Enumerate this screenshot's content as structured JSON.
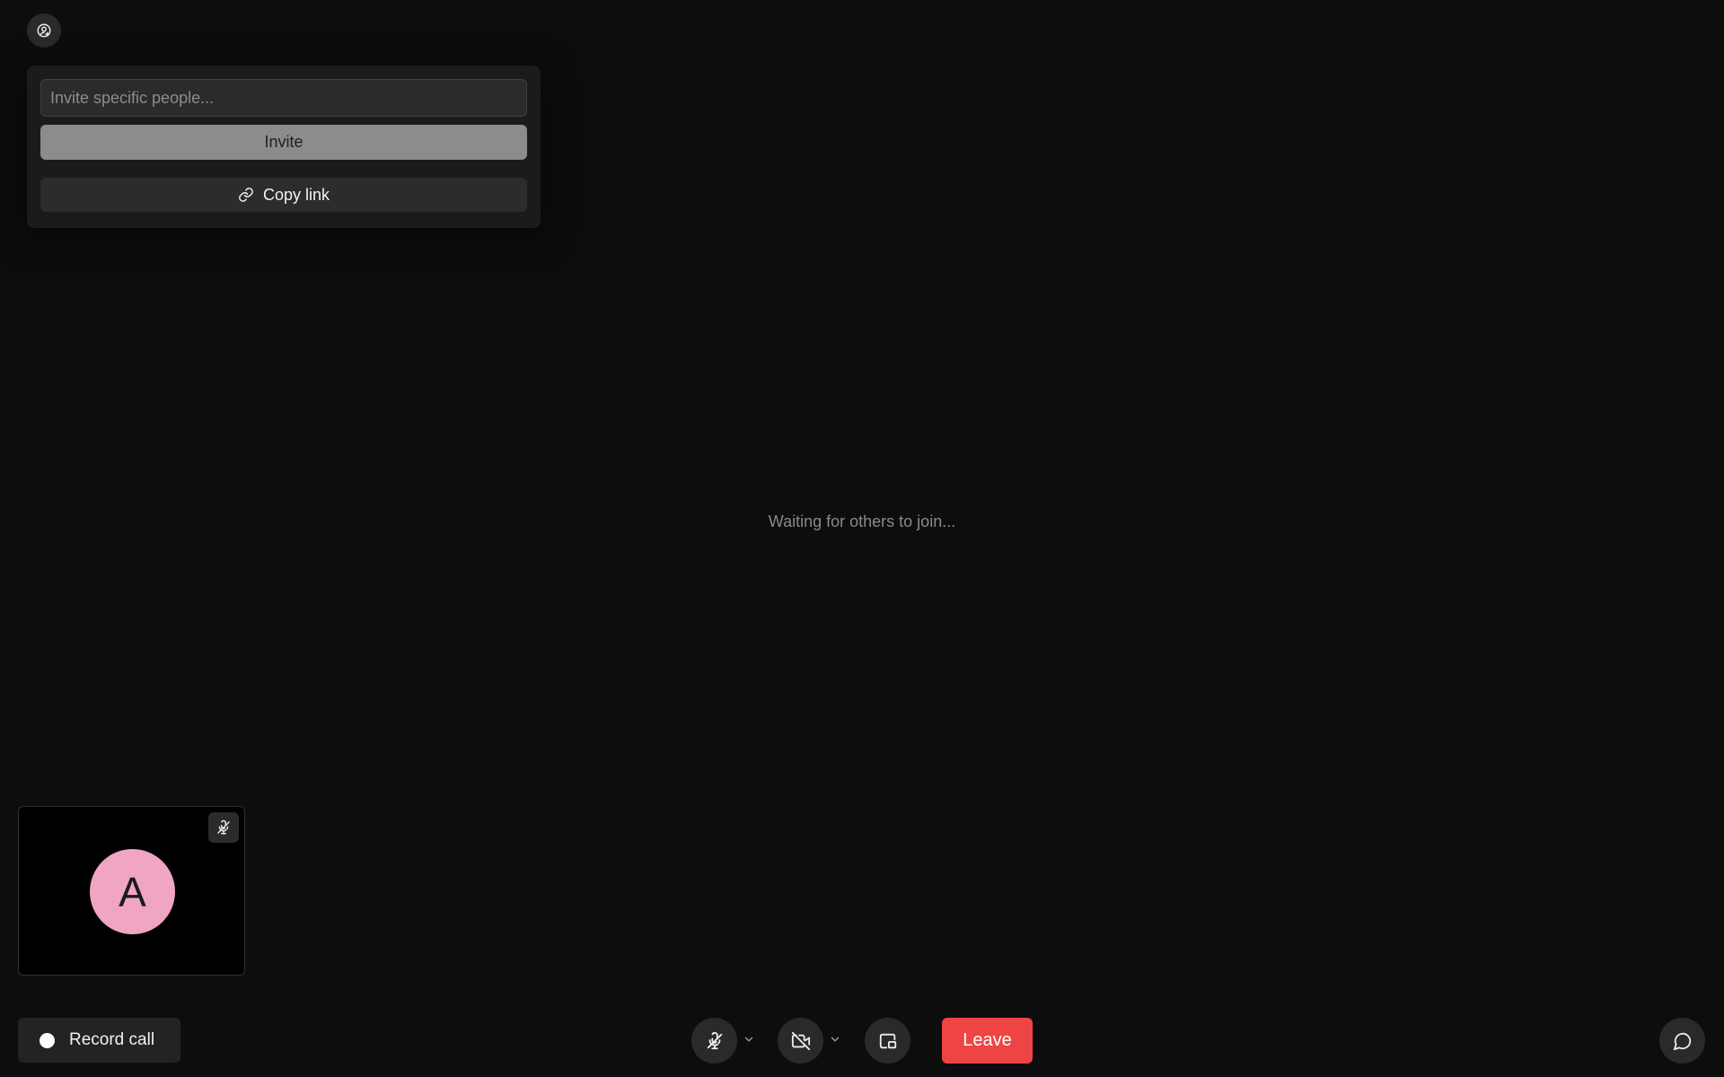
{
  "invite_panel": {
    "toggle_icon": "user-add-icon",
    "input_placeholder": "Invite specific people...",
    "invite_label": "Invite",
    "copy_link_label": "Copy link",
    "copy_link_icon": "link-icon"
  },
  "status": {
    "waiting_text": "Waiting for others to join..."
  },
  "self_tile": {
    "avatar_initial": "A",
    "avatar_color": "#f0a5c3",
    "mic_state": "muted",
    "mic_icon": "mic-off-icon"
  },
  "controls": {
    "record_label": "Record call",
    "mic_icon": "mic-off-icon",
    "camera_icon": "video-off-icon",
    "share_icon": "screen-share-icon",
    "leave_label": "Leave",
    "leave_color": "#ef4444",
    "chat_icon": "chat-icon"
  }
}
